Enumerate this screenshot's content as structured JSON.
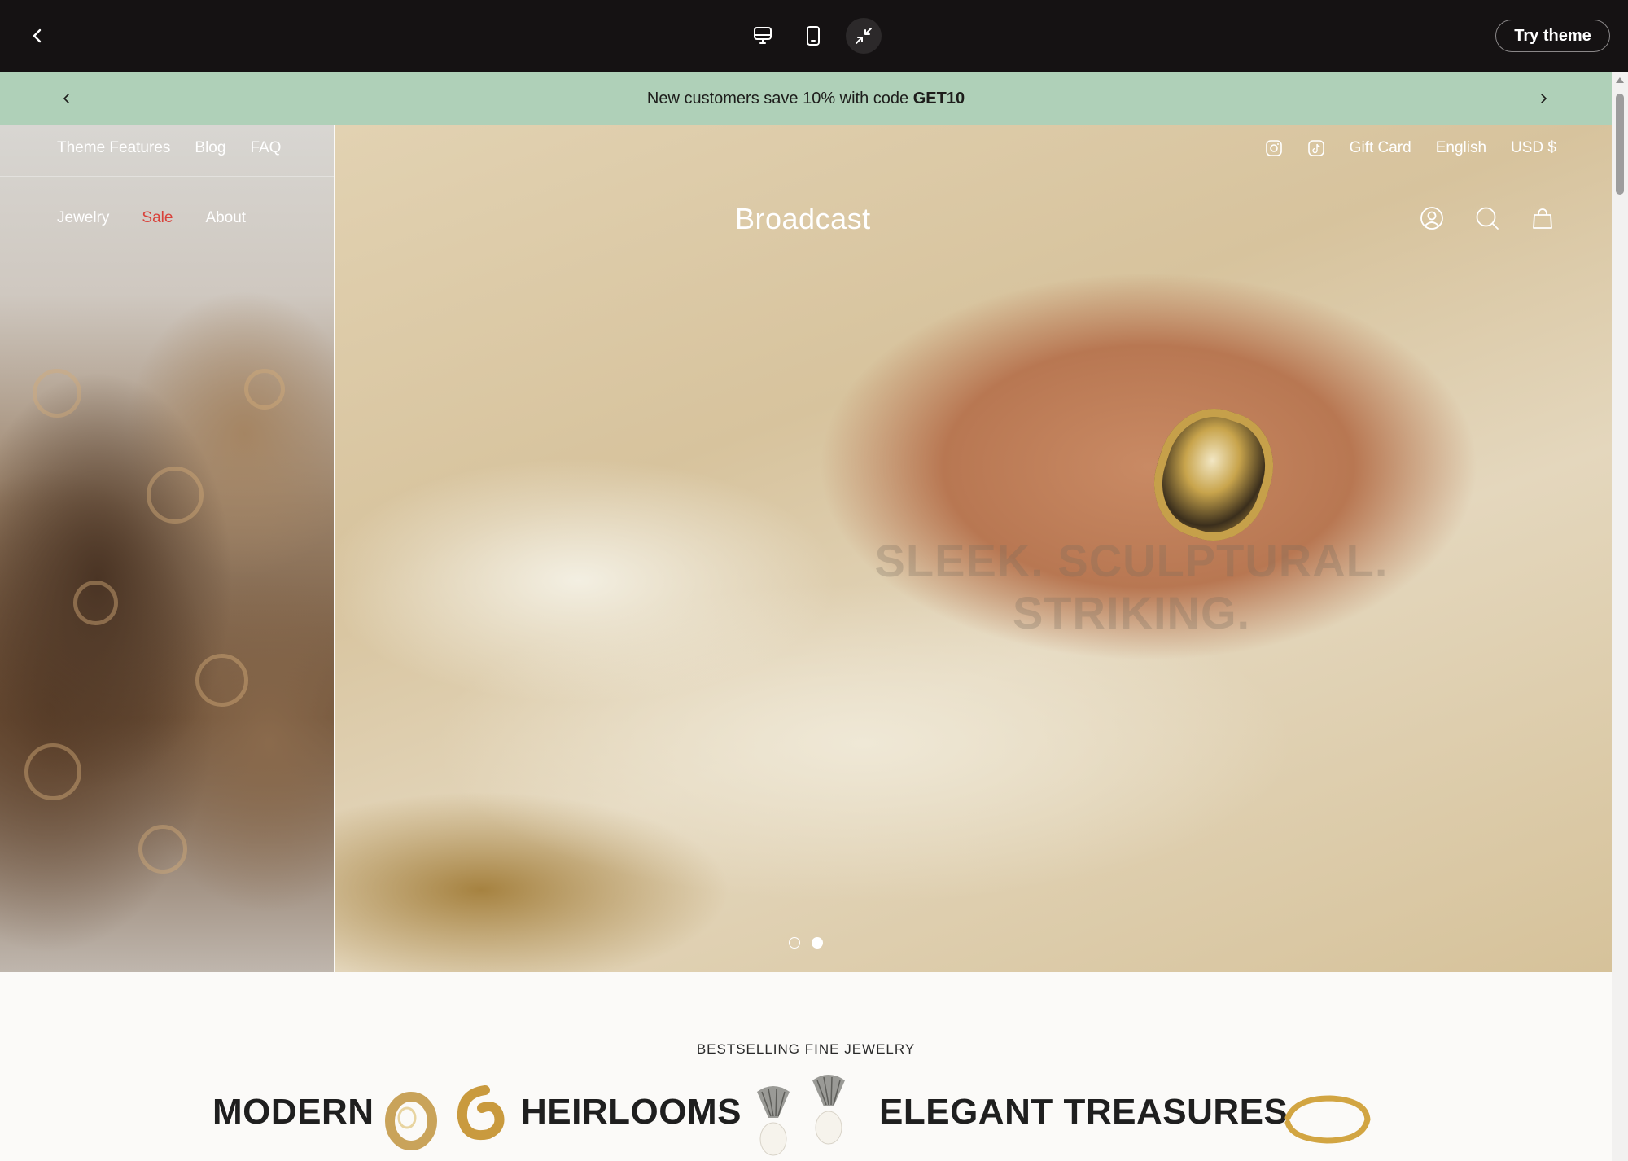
{
  "topbar": {
    "try_label": "Try theme",
    "icons": [
      "back-arrow-icon",
      "desktop-icon",
      "mobile-icon",
      "collapse-icon"
    ]
  },
  "announcement": {
    "text": "New customers save 10% with code ",
    "code": "GET10"
  },
  "nav": {
    "top_links": [
      "Theme Features",
      "Blog",
      "FAQ"
    ],
    "main_links": [
      "Jewelry",
      "Sale",
      "About"
    ]
  },
  "utility": {
    "gift_card": "Gift Card",
    "language": "English",
    "currency": "USD $"
  },
  "brand": {
    "logo": "Broadcast"
  },
  "hero": {
    "headline_line1": "SLEEK. SCULPTURAL.",
    "headline_line2": "STRIKING.",
    "slide_count": 2,
    "active_slide": 2
  },
  "collection": {
    "eyebrow": "BESTSELLING FINE JEWELRY",
    "words": [
      "MODERN",
      "HEIRLOOMS",
      "ELEGANT TREASURES"
    ]
  },
  "colors": {
    "topbar": "#151213",
    "announcement": "#afd0b8",
    "sale": "#d9413a",
    "page": "#fbfaf8"
  }
}
